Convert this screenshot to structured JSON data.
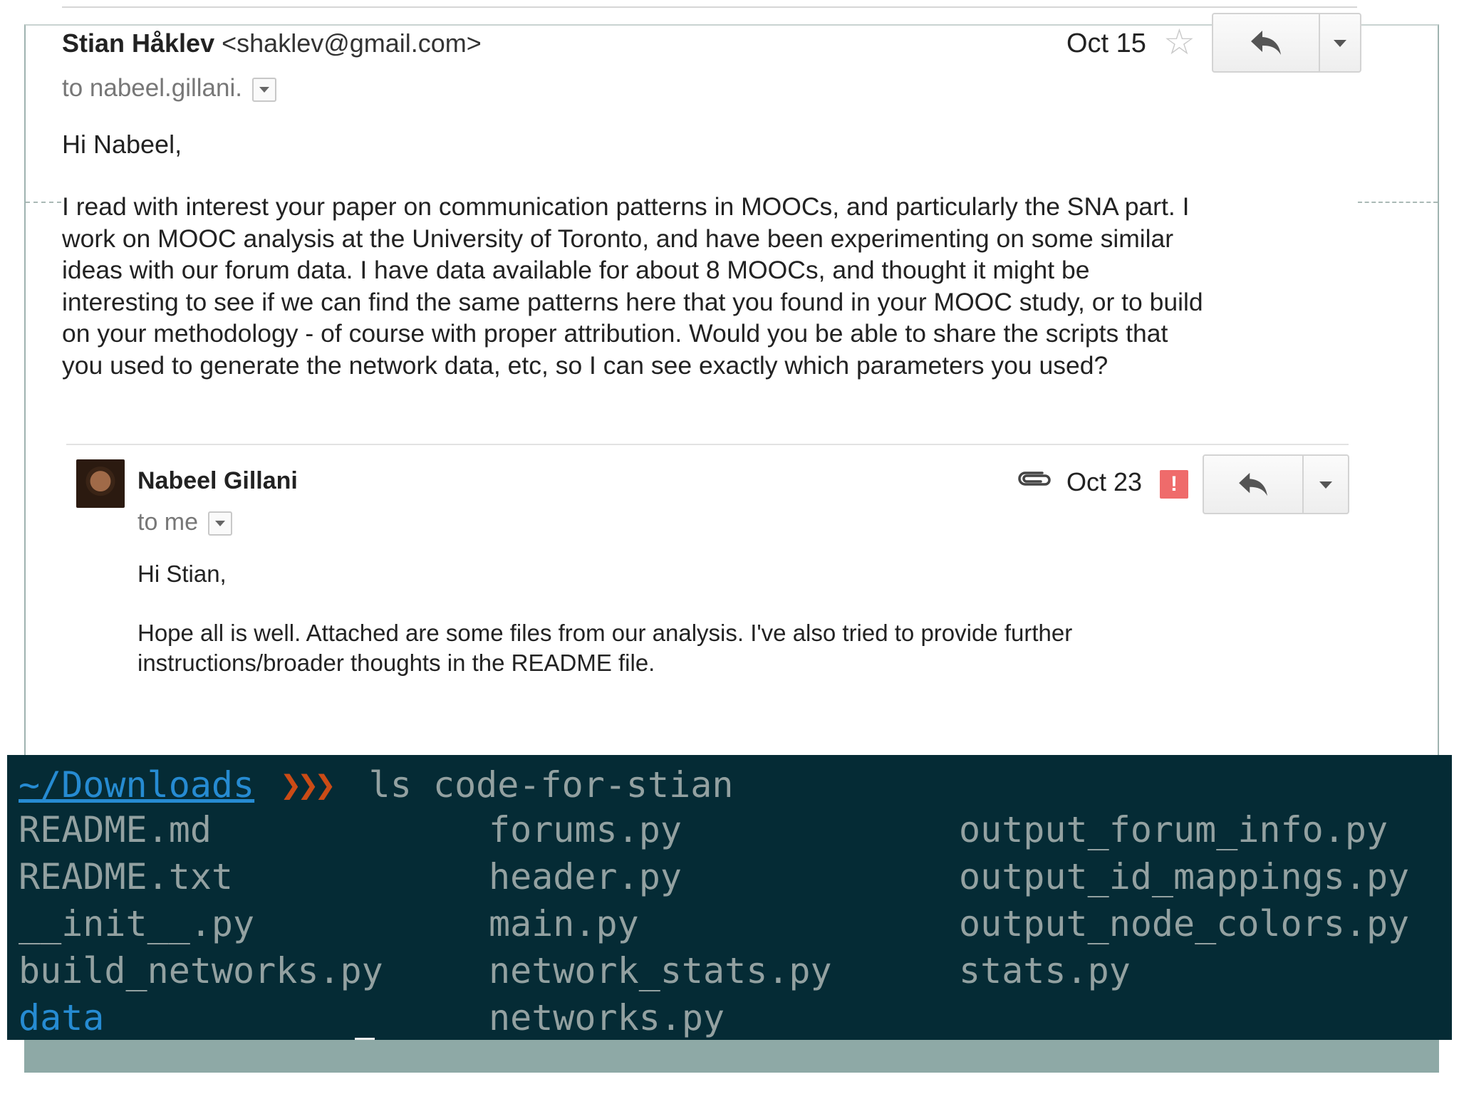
{
  "email": {
    "sender_name": "Stian Håklev",
    "sender_address": "<shaklev@gmail.com>",
    "to": "to nabeel.gillani.",
    "date": "Oct 15",
    "greeting": "Hi Nabeel,",
    "body_lines": [
      "I read with interest your paper on communication patterns in MOOCs, and particularly the SNA part. I",
      "work on MOOC analysis at the University of Toronto, and have been experimenting on some similar",
      "ideas with our forum data. I have data available for about 8 MOOCs, and thought it might be",
      "interesting to see if we can find the same patterns here that you found in your MOOC study, or to build",
      "on your methodology - of course with proper attribution. Would you be able to share the scripts that",
      "you used to generate the network data, etc, so I can see exactly which parameters you used?"
    ],
    "icons": {
      "star": "star-icon",
      "reply": "reply-icon",
      "more": "chevron-down-icon"
    }
  },
  "reply": {
    "sender_name": "Nabeel Gillani",
    "to": "to me",
    "date": "Oct 23",
    "importance_marker": "!",
    "greeting": "Hi Stian,",
    "body_lines": [
      "Hope all is well.  Attached are some files from our analysis.  I've also tried to provide further",
      "instructions/broader thoughts in the README file."
    ],
    "icons": {
      "attachment": "paperclip-icon",
      "importance": "important-icon",
      "reply": "reply-icon",
      "more": "chevron-down-icon"
    }
  },
  "terminal": {
    "path": "~/Downloads",
    "arrows": "❯❯❯",
    "command": "ls code-for-stian",
    "columns": [
      [
        "README.md",
        "README.txt",
        "__init__.py",
        "build_networks.py",
        "data"
      ],
      [
        "forums.py",
        "header.py",
        "main.py",
        "network_stats.py",
        "networks.py"
      ],
      [
        "output_forum_info.py",
        "output_id_mappings.py",
        "output_node_colors.py",
        "stats.py"
      ]
    ],
    "colors": {
      "background": "#052b35",
      "text": "#93a1a1",
      "directory": "#268bd2",
      "prompt_arrow": "#cb4b16"
    }
  }
}
